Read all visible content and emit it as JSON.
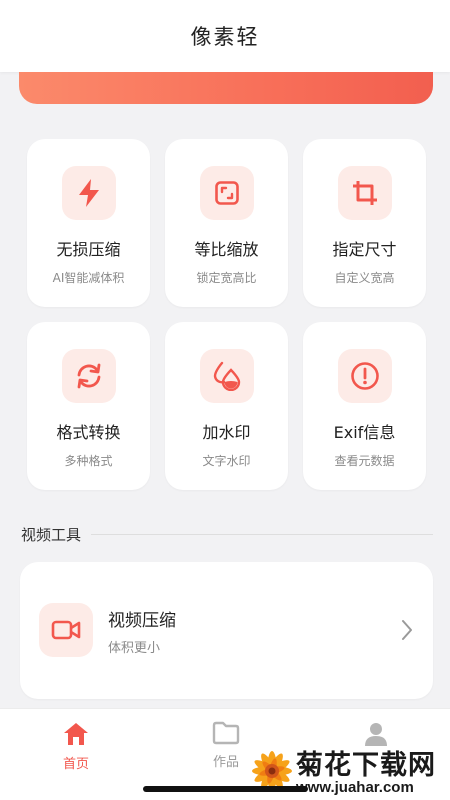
{
  "header": {
    "title": "像素轻"
  },
  "colors": {
    "accent": "#f2574d",
    "icon_bg": "#fdebe7",
    "banner_start": "#fb8a6b",
    "banner_end": "#f25f4f"
  },
  "tools": [
    {
      "label": "无损压缩",
      "sub": "AI智能减体积",
      "icon": "lightning-icon"
    },
    {
      "label": "等比缩放",
      "sub": "锁定宽高比",
      "icon": "scale-icon"
    },
    {
      "label": "指定尺寸",
      "sub": "自定义宽高",
      "icon": "crop-icon"
    },
    {
      "label": "格式转换",
      "sub": "多种格式",
      "icon": "convert-icon"
    },
    {
      "label": "加水印",
      "sub": "文字水印",
      "icon": "watermark-drops-icon"
    },
    {
      "label": "Exif信息",
      "sub": "查看元数据",
      "icon": "info-icon"
    }
  ],
  "video_section": {
    "title": "视频工具",
    "items": [
      {
        "label": "视频压缩",
        "sub": "体积更小",
        "icon": "video-camera-icon"
      }
    ]
  },
  "tabbar": {
    "tabs": [
      {
        "label": "首页",
        "icon": "home-icon",
        "active": true
      },
      {
        "label": "作品",
        "icon": "folder-icon",
        "active": false
      },
      {
        "label": "",
        "icon": "user-icon",
        "active": false
      }
    ]
  },
  "watermark": {
    "cn": "菊花下载网",
    "en": "www.juahar.com"
  }
}
